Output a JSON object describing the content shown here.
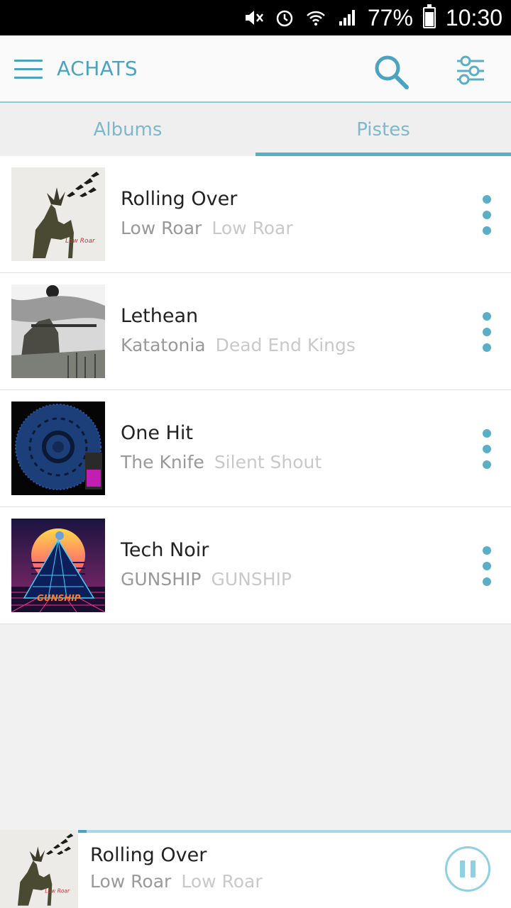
{
  "status_bar": {
    "battery": "77%",
    "time": "10:30",
    "icons": [
      "mute-icon",
      "alarm-icon",
      "wifi-icon",
      "signal-icon",
      "battery-icon"
    ]
  },
  "app_bar": {
    "title": "ACHATS",
    "icons": [
      "menu-icon",
      "search-icon",
      "filter-icon"
    ],
    "accent_color": "#4aa3c0"
  },
  "tabs": [
    {
      "label": "Albums",
      "active": false
    },
    {
      "label": "Pistes",
      "active": true
    }
  ],
  "tracks": [
    {
      "title": "Rolling Over",
      "artist": "Low Roar",
      "album": "Low Roar"
    },
    {
      "title": "Lethean",
      "artist": "Katatonia",
      "album": "Dead End Kings"
    },
    {
      "title": "One Hit",
      "artist": "The Knife",
      "album": "Silent Shout"
    },
    {
      "title": "Tech Noir",
      "artist": "GUNSHIP",
      "album": "GUNSHIP"
    }
  ],
  "now_playing": {
    "title": "Rolling Over",
    "artist": "Low Roar",
    "album": "Low Roar",
    "progress": 0.02,
    "state_icon": "pause-icon"
  }
}
